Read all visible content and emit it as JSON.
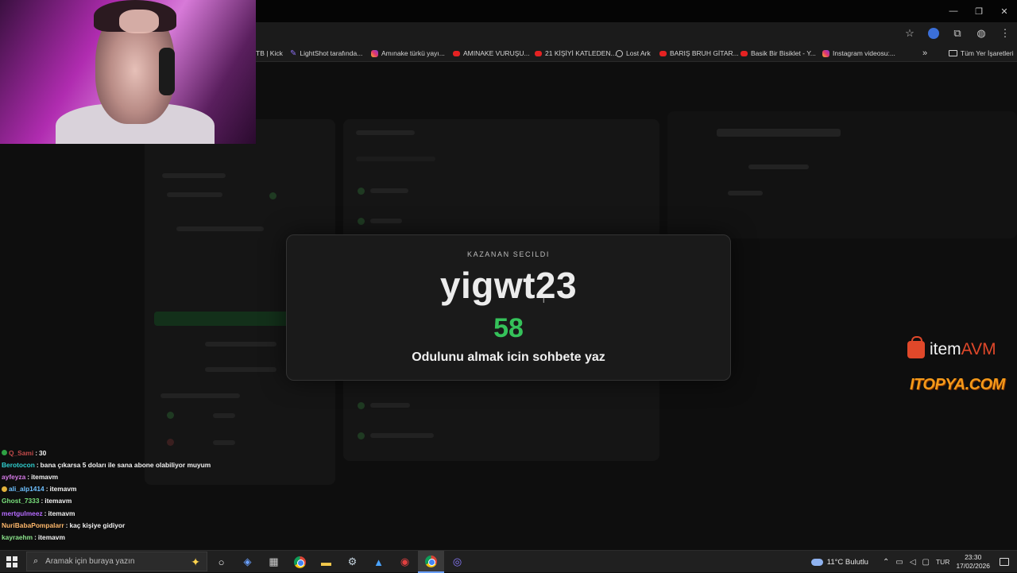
{
  "browser": {
    "window_controls": [
      "—",
      "❐",
      "✕"
    ],
    "bookmarks": [
      {
        "label": "TB | Kick",
        "icon": "none"
      },
      {
        "label": "LightShot tarafında...",
        "icon": "feather-icon"
      },
      {
        "label": "Amınake türkü yayı...",
        "icon": "instagram-icon"
      },
      {
        "label": "AMINAKE VURUŞU...",
        "icon": "youtube-icon"
      },
      {
        "label": "21 KİŞİYİ KATLEDEN...",
        "icon": "youtube-icon"
      },
      {
        "label": "Lost Ark",
        "icon": "globe-icon"
      },
      {
        "label": "BARIŞ BRUH GİTAR...",
        "icon": "youtube-icon"
      },
      {
        "label": "Basik Bir Bisiklet - Y...",
        "icon": "youtube-icon"
      },
      {
        "label": "Instagram videosu:...",
        "icon": "instagram-icon"
      }
    ],
    "more_bookmarks": "»",
    "all_bookmarks": "Tüm Yer İşaretleri"
  },
  "modal": {
    "subtitle": "KAZANAN SECILDI",
    "winner": "yigwt23",
    "number": "58",
    "message": "Odulunu almak icin sohbete yaz"
  },
  "sponsors": {
    "itemavm_prefix": "item",
    "itemavm_suffix": "AVM",
    "itopya": "ITOPYA.COM"
  },
  "chat": [
    {
      "user": "Q_Sami",
      "color": "#c24a4a",
      "badge": "#2ea043",
      "text": "30"
    },
    {
      "user": "Berotocon",
      "color": "#2fd0d0",
      "badge": "",
      "text": "bana çıkarsa 5 doları ile sana abone olabiliyor muyum"
    },
    {
      "user": "ayfeyza",
      "color": "#d57ae6",
      "badge": "",
      "text": "itemavm"
    },
    {
      "user": "ali_alp1414",
      "color": "#6ec0ff",
      "badge": "#e3b23c",
      "text": "itemavm"
    },
    {
      "user": "Ghost_7333",
      "color": "#79e07c",
      "badge": "",
      "text": "itemavm"
    },
    {
      "user": "mertgulmeez",
      "color": "#b66bff",
      "badge": "",
      "text": "itemavm"
    },
    {
      "user": "NuriBabaPompalarr",
      "color": "#ffb86b",
      "badge": "",
      "text": "kaç kişiye gidiyor"
    },
    {
      "user": "kayraehm",
      "color": "#8be38b",
      "badge": "",
      "text": "itemavm"
    }
  ],
  "taskbar": {
    "search_placeholder": "Aramak için buraya yazın",
    "weather": "11°C  Bulutlu",
    "language": "TUR",
    "time": "23:30",
    "date": "17/02/2026"
  }
}
